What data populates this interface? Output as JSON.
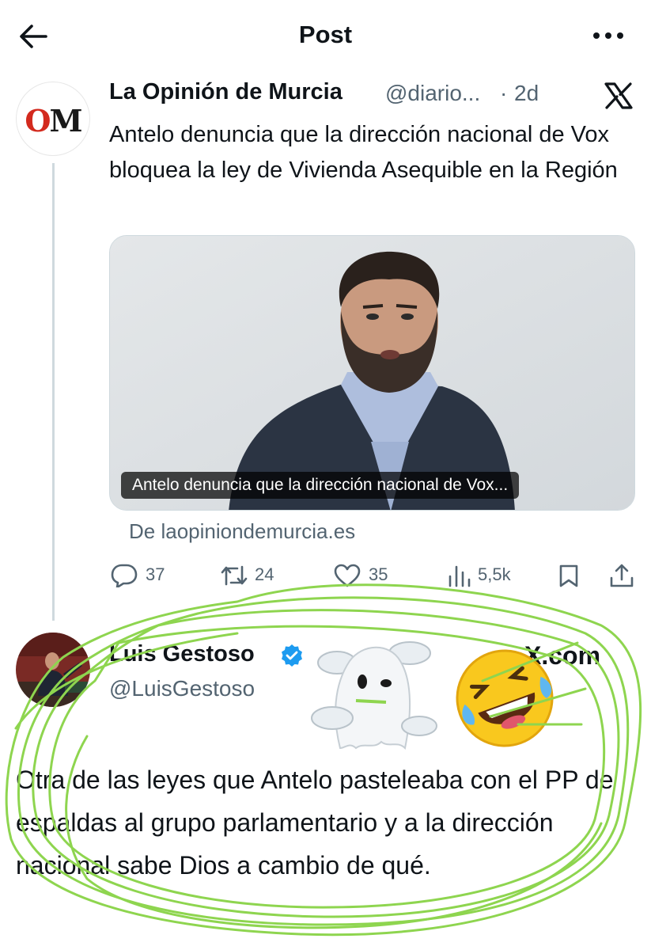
{
  "header": {
    "title": "Post"
  },
  "original_post": {
    "avatar_text_o": "O",
    "avatar_text_m": "M",
    "name": "La Opinión de Murcia",
    "handle": "@diario...",
    "dot": "·",
    "time": "2d",
    "text": "Antelo denuncia que la dirección nacional de Vox bloquea la ley de Vivienda Asequible en la Región",
    "media_caption": "Antelo denuncia que la dirección nacional de Vox...",
    "source": "De laopiniondemurcia.es",
    "stats": {
      "replies": "37",
      "reposts": "24",
      "likes": "35",
      "views": "5,5k"
    }
  },
  "quote_post": {
    "name": "Luis Gestoso",
    "handle": "@LuisGestoso",
    "watermark": "X.com",
    "text": "Otra de las leyes que Antelo pasteleaba con el PP de espaldas al grupo parlamentario y a la dirección nacional sabe Dios a cambio de qué."
  },
  "colors": {
    "text": "#0f1419",
    "secondary": "#536471",
    "verified": "#1d9bf0",
    "annotation": "#8ed54f",
    "brand_red": "#d32a1e"
  },
  "icons": [
    "back-arrow-icon",
    "more-icon",
    "x-logo-icon",
    "reply-icon",
    "repost-icon",
    "like-icon",
    "views-icon",
    "bookmark-icon",
    "share-icon",
    "verified-icon",
    "ghost-emoji",
    "laughing-emoji"
  ]
}
